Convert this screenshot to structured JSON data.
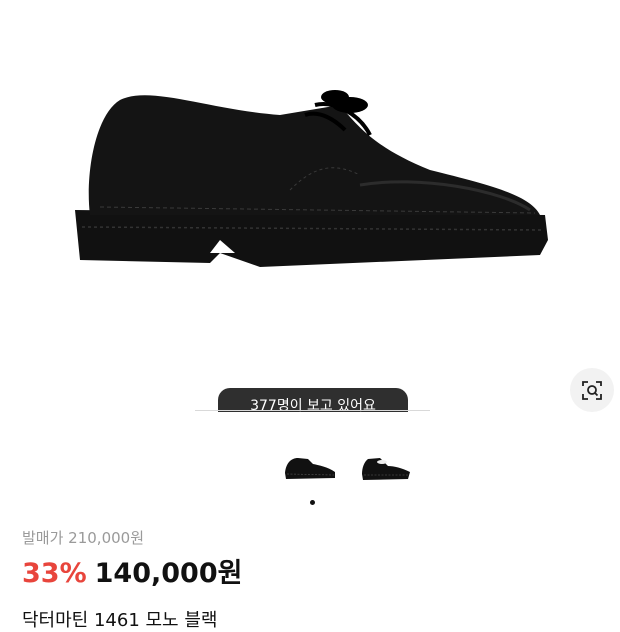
{
  "product": {
    "image_alt": "Dr. Martens 1461 Mono black shoe",
    "viewing_text": "377명이 보고 있어요",
    "original_price": "발매가 210,000원",
    "discount": "33%",
    "price": "140,000원",
    "title": "닥터마틴 1461 모노 블랙"
  },
  "gallery": {
    "thumbnails": [
      "shoe-side-view",
      "shoe-angle-view"
    ],
    "active_index": 0
  },
  "icons": {
    "lens": "lens-search-icon"
  },
  "colors": {
    "discount": "#e8453c",
    "pill_bg": "#2f2f2f"
  }
}
